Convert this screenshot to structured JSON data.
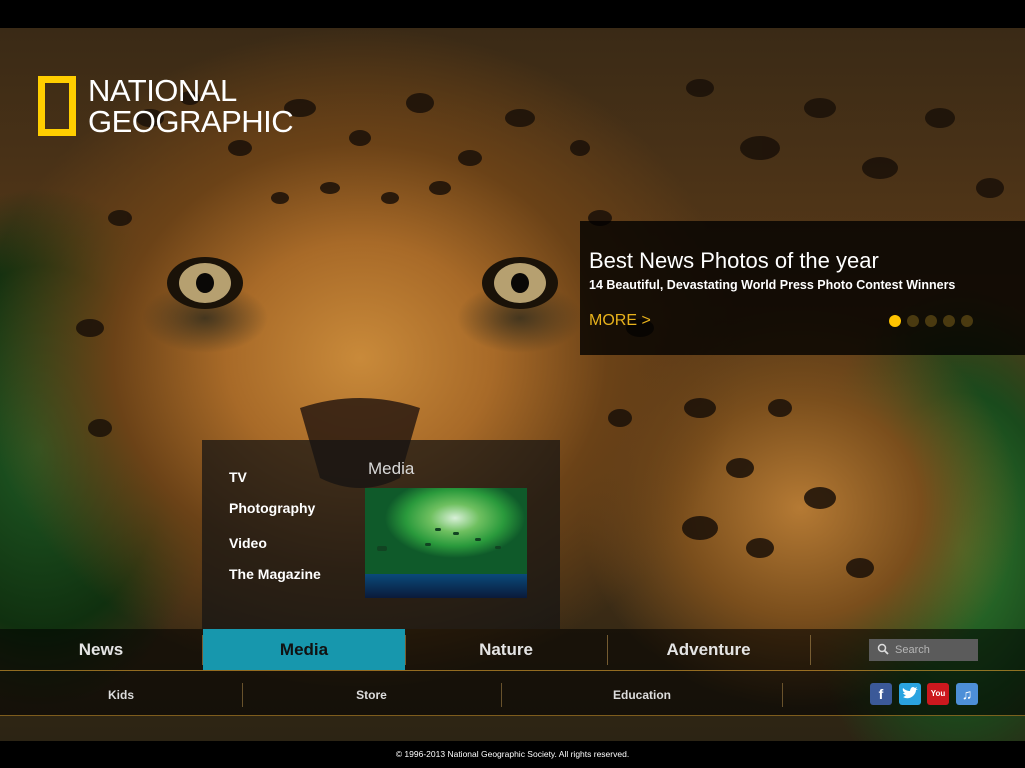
{
  "brand": {
    "line1": "NATIONAL",
    "line2": "GEOGRAPHIC",
    "frame_color": "#ffce00"
  },
  "promo": {
    "title": "Best News Photos of the year",
    "subtitle": "14 Beautiful, Devastating World Press Photo Contest Winners",
    "more": "MORE >",
    "slides_total": 5,
    "active_slide": 1,
    "accent": "#e8b21c"
  },
  "dropdown": {
    "heading": "Media",
    "items": [
      "TV",
      "Photography",
      "Video",
      "The Magazine"
    ]
  },
  "nav": {
    "items": [
      "News",
      "Media",
      "Nature",
      "Adventure"
    ],
    "active": "Media",
    "active_color": "#1797ad"
  },
  "search": {
    "placeholder": "Search"
  },
  "subnav": {
    "items": [
      "Kids",
      "Store",
      "Education"
    ]
  },
  "social": [
    {
      "icon": "facebook-icon",
      "color": "#3b5998"
    },
    {
      "icon": "twitter-icon",
      "color": "#2aa3e0"
    },
    {
      "icon": "youtube-icon",
      "color": "#cc181e"
    },
    {
      "icon": "itunes-icon",
      "color": "#4d8fd8"
    }
  ],
  "footer": {
    "copyright": "© 1996-2013 National Geographic Society. All rights reserved."
  }
}
